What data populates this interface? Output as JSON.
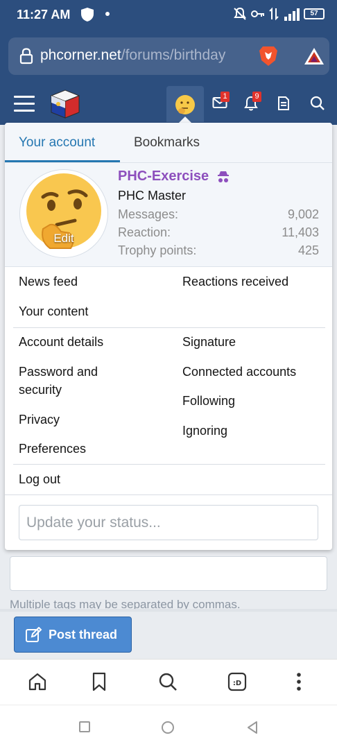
{
  "status_bar": {
    "time": "11:27 AM",
    "battery": "57"
  },
  "browser": {
    "url_host": "phcorner.net",
    "url_path": "/forums/birthday"
  },
  "header": {
    "notifications": {
      "inbox_count": "1",
      "alerts_count": "9"
    }
  },
  "menu": {
    "tabs": {
      "your_account": "Your account",
      "bookmarks": "Bookmarks"
    },
    "profile": {
      "avatar_edit": "Edit",
      "username": "PHC-Exercise",
      "user_title": "PHC Master",
      "stats": [
        {
          "label": "Messages:",
          "value": "9,002"
        },
        {
          "label": "Reaction:",
          "value": "11,403"
        },
        {
          "label": "Trophy points:",
          "value": "425"
        }
      ]
    },
    "links": {
      "news_feed": "News feed",
      "reactions_received": "Reactions received",
      "your_content": "Your content",
      "account_details": "Account details",
      "signature": "Signature",
      "password_security_1": "Password and",
      "password_security_2": "security",
      "connected_accounts": "Connected accounts",
      "following": "Following",
      "privacy": "Privacy",
      "ignoring": "Ignoring",
      "preferences": "Preferences",
      "log_out": "Log out"
    },
    "status_placeholder": "Update your status..."
  },
  "page": {
    "tags_hint": "Multiple tags may be separated by commas.",
    "post_thread": "Post thread"
  },
  "colors": {
    "header": "#2c4e7e",
    "accent": "#2577b1",
    "username": "#8d4fbd",
    "button": "#4c8ad2"
  }
}
